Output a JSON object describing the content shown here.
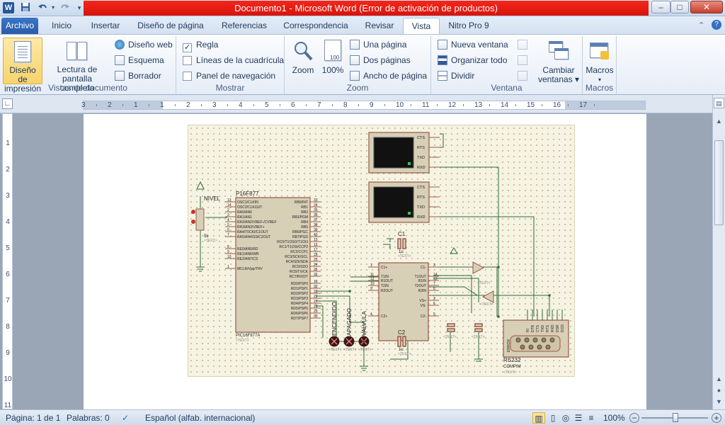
{
  "window": {
    "title": "Documento1  -  Microsoft Word (Error de activación de productos)",
    "app_icon": "W",
    "minimize": "–",
    "maximize": "□",
    "close": "✕"
  },
  "quick_access": [
    "save-icon",
    "undo-icon",
    "redo-icon",
    "customize-icon"
  ],
  "tabs": [
    "Archivo",
    "Inicio",
    "Insertar",
    "Diseño de página",
    "Referencias",
    "Correspondencia",
    "Revisar",
    "Vista",
    "Nitro Pro 9"
  ],
  "active_tab": "Vista",
  "ribbon": {
    "vistas": {
      "group": "Vistas de documento",
      "print_layout": [
        "Diseño de",
        "impresión"
      ],
      "full_screen": [
        "Lectura de",
        "pantalla completa"
      ],
      "web": "Diseño web",
      "outline": "Esquema",
      "draft": "Borrador"
    },
    "mostrar": {
      "group": "Mostrar",
      "ruler": "Regla",
      "gridlines": "Líneas de la cuadrícula",
      "nav_pane": "Panel de navegación",
      "ruler_checked": "✓"
    },
    "zoom": {
      "group": "Zoom",
      "zoom": "Zoom",
      "hundred": "100%",
      "one_page": "Una página",
      "two_pages": "Dos páginas",
      "page_width": "Ancho de página"
    },
    "ventana": {
      "group": "Ventana",
      "new_window": "Nueva ventana",
      "arrange_all": "Organizar todo",
      "split": "Dividir",
      "switch": [
        "Cambiar",
        "ventanas ▾"
      ]
    },
    "macros": {
      "group": "Macros",
      "label": "Macros"
    }
  },
  "ruler_numbers": [
    "3",
    "2",
    "1",
    "1",
    "2",
    "3",
    "4",
    "5",
    "6",
    "7",
    "8",
    "9",
    "10",
    "11",
    "12",
    "13",
    "14",
    "15",
    "16",
    "17"
  ],
  "vruler_numbers": [
    "1",
    "2",
    "3",
    "4",
    "5",
    "6",
    "7",
    "8",
    "9",
    "10",
    "11"
  ],
  "schematic": {
    "mcu_label": "P16F877",
    "mcu_part": "PIC16F877A",
    "text_tag": "<TEXT>",
    "nivel": "NIVEL",
    "pot_value": "5k",
    "c1": "C1",
    "c2": "C2",
    "c1_value": "1u",
    "c2_value": "1u",
    "rs232": "RS232",
    "compim": "COMPIM",
    "error_tag": "ERROR",
    "leds": [
      "ENCENDIDO",
      "APAGADO",
      "VALVULA"
    ],
    "terminal_pins": [
      "CTS",
      "RTS",
      "TXD",
      "RXD"
    ],
    "mcu_left_pins": [
      "OSC1/CLKIN",
      "OSC2/CLKOUT",
      "RA0/AN0",
      "RA1/AN1",
      "RA2/AN2/VREF-/CVREF",
      "RA3/AN3/VREF+",
      "RA4/T0CKI/C1OUT",
      "RA5/AN4/SS/C2OUT",
      "RE0/AN5/RD",
      "RE1/AN6/WR",
      "RE2/AN7/CS",
      "MCLR/Vpp/THV"
    ],
    "mcu_left_nums": [
      "13",
      "14",
      "2",
      "3",
      "4",
      "5",
      "6",
      "7",
      "8",
      "9",
      "10",
      "1"
    ],
    "mcu_right_pins": [
      "RB0/INT",
      "RB1",
      "RB2",
      "RB3/PGM",
      "RB4",
      "RB5",
      "RB6/PGC",
      "RB7/PGD",
      "RC0/T1OSO/T1CKI",
      "RC1/T1OSI/CCP2",
      "RC2/CCP1",
      "RC3/SCK/SCL",
      "RC4/SDI/SDA",
      "RC5/SDO",
      "RC6/TX/CK",
      "RC7/RX/DT",
      "RD0/PSP0",
      "RD1/PSP1",
      "RD2/PSP2",
      "RD3/PSP3",
      "RD4/PSP4",
      "RD5/PSP5",
      "RD6/PSP6",
      "RD7/PSP7"
    ],
    "mcu_right_nums": [
      "33",
      "34",
      "35",
      "36",
      "37",
      "38",
      "39",
      "40",
      "15",
      "16",
      "17",
      "18",
      "23",
      "24",
      "25",
      "26",
      "19",
      "20",
      "21",
      "22",
      "27",
      "28",
      "29",
      "30"
    ],
    "max_left": [
      "C1+",
      "T1IN",
      "R1OUT",
      "T2IN",
      "R2OUT",
      "C2+"
    ],
    "max_left_nums": [
      "1",
      "11",
      "12",
      "10",
      "9",
      "4"
    ],
    "max_right": [
      "C1-",
      "T1OUT",
      "R1IN",
      "T2OUT",
      "R2IN",
      "VS+",
      "VS-",
      "C2-"
    ],
    "max_right_nums": [
      "3",
      "14",
      "13",
      "7",
      "8",
      "2",
      "6",
      "5"
    ],
    "db9_pins": [
      "DCD",
      "DSR",
      "RXD",
      "RTS",
      "TXD",
      "CTS",
      "DTR",
      "RI"
    ]
  },
  "status": {
    "page": "Página: 1 de 1",
    "words": "Palabras: 0",
    "language": "Español (alfab. internacional)",
    "zoom": "100%",
    "zoom_minus": "−",
    "zoom_plus": "+"
  }
}
